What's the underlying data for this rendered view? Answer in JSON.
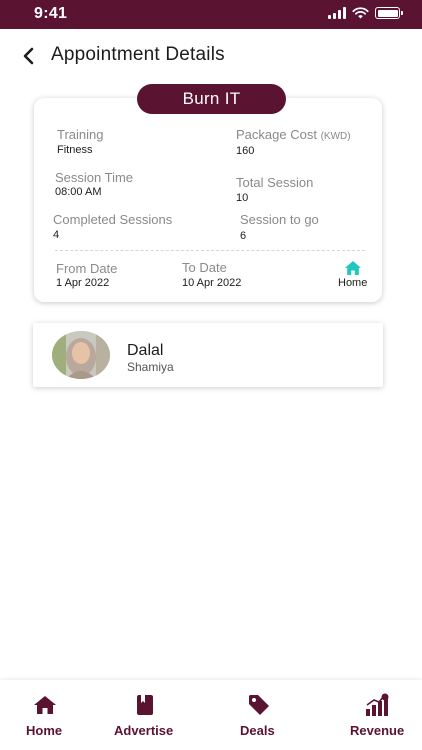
{
  "status_bar": {
    "time": "9:41"
  },
  "header": {
    "title": "Appointment Details"
  },
  "card": {
    "title": "Burn IT",
    "training_label": "Training",
    "training_value": "Fitness",
    "package_cost_label": "Package Cost",
    "package_cost_unit": "(KWD)",
    "package_cost_value": "160",
    "session_time_label": "Session Time",
    "session_time_value": "08:00 AM",
    "total_session_label": "Total Session",
    "total_session_value": "10",
    "completed_sessions_label": "Completed Sessions",
    "completed_sessions_value": "4",
    "session_to_go_label": "Session to go",
    "session_to_go_value": "6",
    "from_date_label": "From Date",
    "from_date_value": "1 Apr 2022",
    "to_date_label": "To Date",
    "to_date_value": "10 Apr 2022",
    "location_label": "Home",
    "location_icon": "home-icon",
    "location_icon_color": "#1fc7c0"
  },
  "person": {
    "name": "Dalal",
    "subtitle": "Shamiya"
  },
  "bottom_nav": {
    "items": [
      {
        "label": "Home",
        "icon": "home-icon"
      },
      {
        "label": "Advertise",
        "icon": "book-icon"
      },
      {
        "label": "Deals",
        "icon": "tag-icon"
      },
      {
        "label": "Revenue",
        "icon": "revenue-chart-icon"
      }
    ]
  },
  "colors": {
    "primary": "#5a1330",
    "accent": "#1fc7c0"
  }
}
